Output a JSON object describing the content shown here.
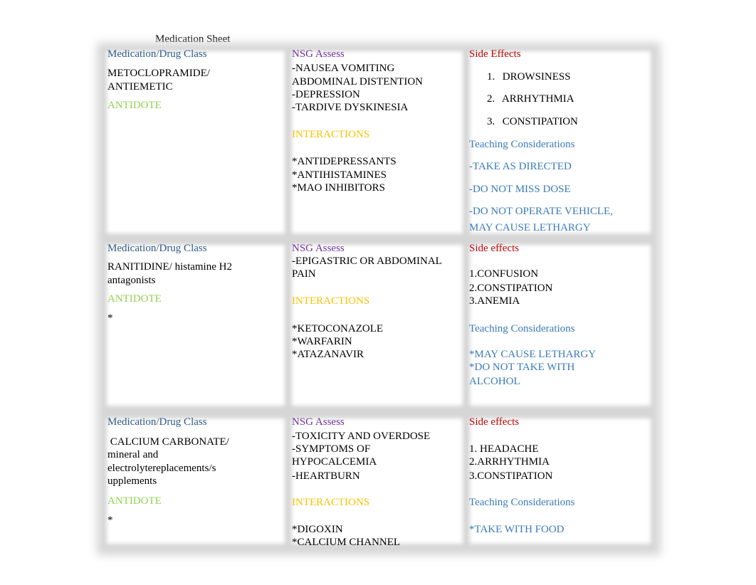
{
  "document": {
    "title": "Medication Sheet"
  },
  "headers": {
    "medication": "Medication/Drug Class",
    "nsg": "NSG Assess",
    "side_effects_row1": "Side Effects",
    "side_effects": "Side effects",
    "antidote": "ANTIDOTE",
    "interactions": "INTERACTIONS",
    "teaching": "Teaching Considerations"
  },
  "colors": {
    "medication_header": "#2e5a8a",
    "nsg_header": "#7030a0",
    "side_effects_header": "#c00000",
    "antidote": "#92d050",
    "interactions": "#ffc000",
    "teaching": "#3a7ab8"
  },
  "rows": [
    {
      "drug_lines": [
        "METOCLOPRAMIDE/",
        "ANTIEMETIC"
      ],
      "antidote_value": "",
      "nsg_lines": [
        "-NAUSEA VOMITING",
        "ABDOMINAL DISTENTION",
        "-DEPRESSION",
        "-TARDIVE DYSKINESIA"
      ],
      "interaction_lines": [
        "*ANTIDEPRESSANTS",
        "*ANTIHISTAMINES",
        "*MAO INHIBITORS"
      ],
      "side_effects": [
        {
          "num": "1.",
          "text": "DROWSINESS"
        },
        {
          "num": "2.",
          "text": "ARRHYTHMIA"
        },
        {
          "num": "3.",
          "text": "CONSTIPATION"
        }
      ],
      "teaching_lines": [
        "-TAKE AS DIRECTED",
        "-DO NOT MISS DOSE",
        "-DO NOT OPERATE VEHICLE,",
        "MAY CAUSE LETHARGY"
      ]
    },
    {
      "drug_lines": [
        "RANITIDINE/ histamine H2",
        "antagonists"
      ],
      "antidote_value": "*",
      "nsg_lines": [
        "-EPIGASTRIC OR ABDOMINAL",
        "PAIN"
      ],
      "interaction_lines": [
        "*KETOCONAZOLE",
        "*WARFARIN",
        "*ATAZANAVIR"
      ],
      "side_effects_lines": [
        "1.CONFUSION",
        "2.CONSTIPATION",
        "3.ANEMIA"
      ],
      "teaching_lines": [
        "*MAY CAUSE LETHARGY",
        "*DO NOT TAKE WITH",
        "ALCOHOL"
      ]
    },
    {
      "drug_lines": [
        " CALCIUM CARBONATE/",
        "mineral and",
        "electrolytereplacements/s",
        "upplements"
      ],
      "antidote_value": "*",
      "nsg_lines": [
        "-TOXICITY AND OVERDOSE",
        "-SYMPTOMS OF",
        "HYPOCALCEMIA",
        "-HEARTBURN"
      ],
      "interaction_lines": [
        "*DIGOXIN",
        "*CALCIUM CHANNEL"
      ],
      "side_effects_lines": [
        "1. HEADACHE",
        "2.ARRHYTHMIA",
        "3.CONSTIPATION"
      ],
      "teaching_lines": [
        "*TAKE WITH FOOD"
      ]
    }
  ]
}
